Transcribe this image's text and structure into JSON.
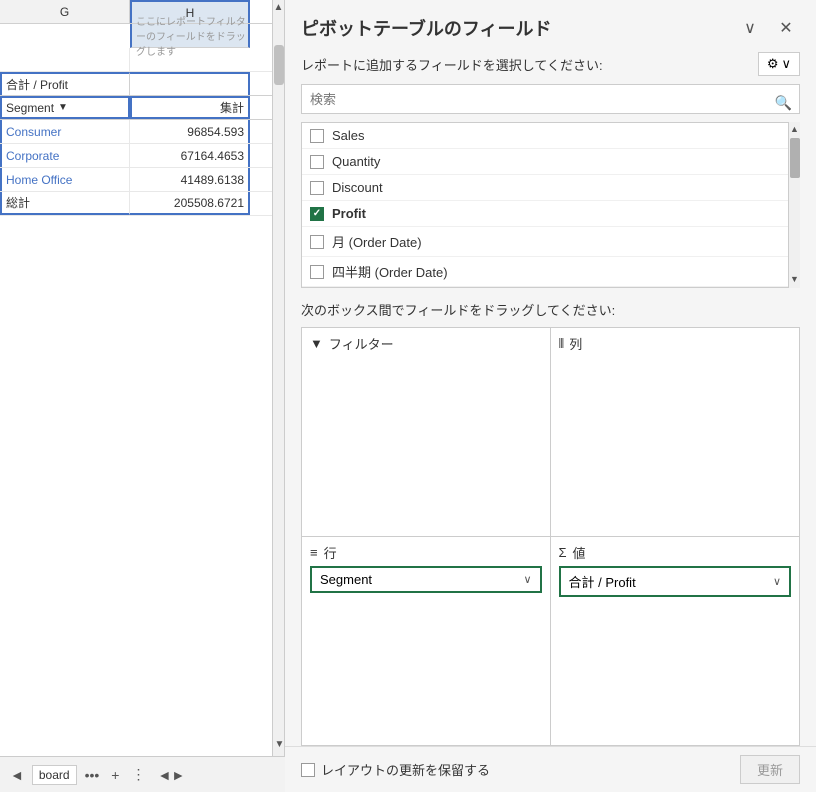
{
  "spreadsheet": {
    "col_g_label": "G",
    "col_h_label": "H",
    "drag_hint": "ここにレポートフィルターのフィールドをドラッグします",
    "table_header_segment": "Segment",
    "table_header_dropdown": "▼",
    "table_header_sum": "集計",
    "rows": [
      {
        "label": "Consumer",
        "value": "96854.593"
      },
      {
        "label": "Corporate",
        "value": "67164.4653"
      },
      {
        "label": "Home Office",
        "value": "41489.6138"
      }
    ],
    "total_label": "総計",
    "total_value": "205508.6721"
  },
  "panel": {
    "title": "ピボットテーブルのフィールド",
    "subtitle": "レポートに追加するフィールドを選択してください:",
    "search_placeholder": "検索",
    "settings_label": "⚙",
    "settings_dropdown": "∨",
    "close_label": "✕",
    "collapse_label": "∨",
    "fields": [
      {
        "name": "Sales",
        "checked": false
      },
      {
        "name": "Quantity",
        "checked": false
      },
      {
        "name": "Discount",
        "checked": false
      },
      {
        "name": "Profit",
        "checked": true
      },
      {
        "name": "月 (Order Date)",
        "checked": false
      },
      {
        "name": "四半期 (Order Date)",
        "checked": false
      }
    ],
    "drag_section_title": "次のボックス間でフィールドをドラッグしてください:",
    "box_filter_label": "フィルター",
    "box_columns_label": "列",
    "box_rows_label": "行",
    "box_values_label": "値",
    "row_field": "Segment",
    "value_field": "合計 / Profit",
    "footer_checkbox_label": "レイアウトの更新を保留する",
    "update_btn_label": "更新",
    "bottom_tab_label": "board",
    "filter_icon": "▼",
    "columns_icon": "|||",
    "rows_icon": "≡",
    "values_icon": "Σ"
  }
}
